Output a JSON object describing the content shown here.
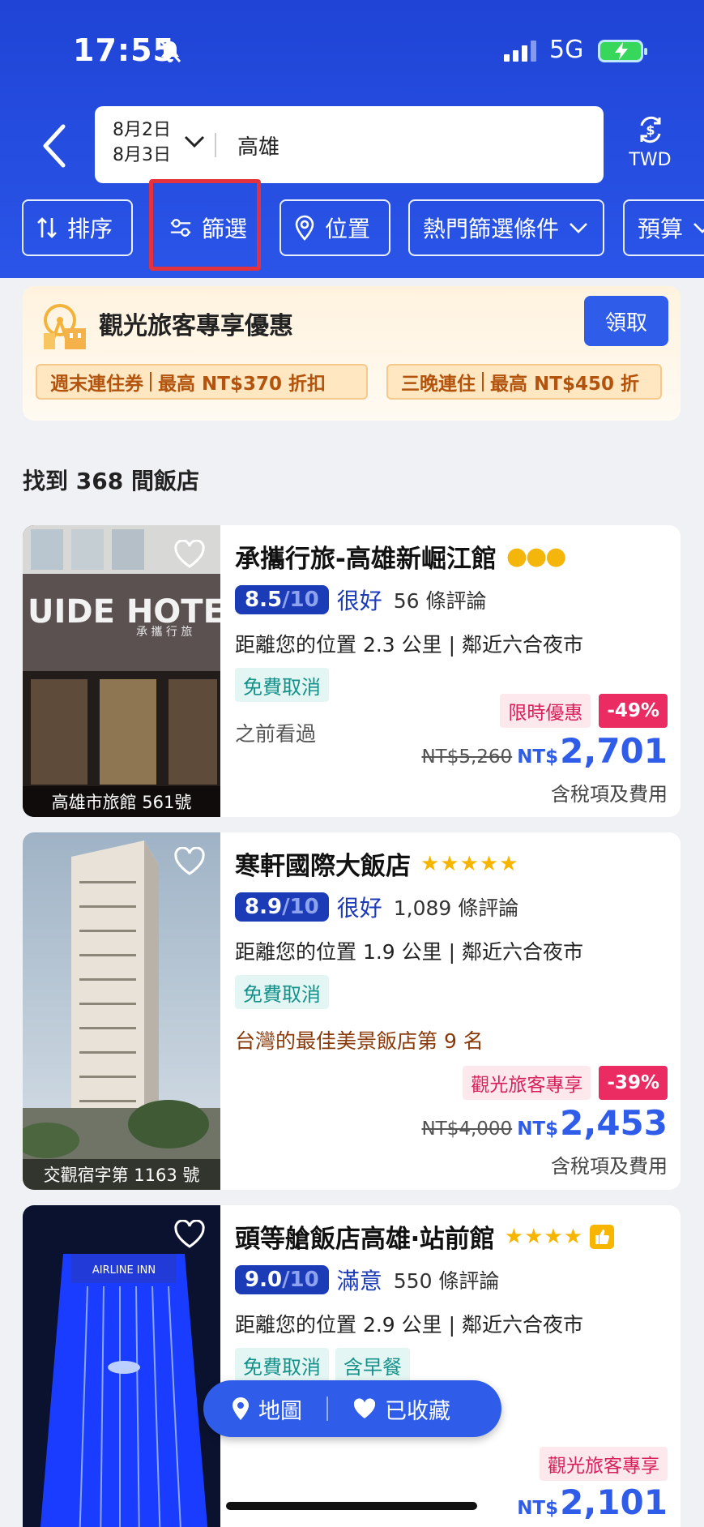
{
  "status": {
    "time": "17:55",
    "network": "5G"
  },
  "search": {
    "date_in": "8月2日",
    "date_out": "8月3日",
    "city": "高雄",
    "currency": "TWD"
  },
  "chips": [
    {
      "label": "排序"
    },
    {
      "label": "篩選"
    },
    {
      "label": "位置"
    },
    {
      "label": "熱門篩選條件"
    },
    {
      "label": "預算"
    }
  ],
  "promo": {
    "title": "觀光旅客專享優惠",
    "claim": "領取",
    "coupons": [
      {
        "name": "週末連住券",
        "desc": "最高 NT$370 折扣"
      },
      {
        "name": "三晚連住",
        "desc": "最高 NT$450 折"
      }
    ]
  },
  "found": "找到 368 間飯店",
  "hotels": [
    {
      "name": "承攜行旅-高雄新崛江館",
      "stars": "●●●",
      "score": "8.5",
      "denom": "/10",
      "word": "很好",
      "reviews": "56 條評論",
      "distance": "距離您的位置 2.3 公里 | 鄰近六合夜市",
      "tags": [
        "免費取消"
      ],
      "note": "之前看過",
      "promo": "限時優惠",
      "discount": "-49%",
      "old": "NT$5,260",
      "currency": "NT$",
      "price": "2,701",
      "tax": "含稅項及費用",
      "license": "高雄市旅館 561號",
      "sign": "UIDE HOTEL",
      "sign2": "承 攜 行 旅"
    },
    {
      "name": "寒軒國際大飯店",
      "stars": "★★★★★",
      "score": "8.9",
      "denom": "/10",
      "word": "很好",
      "reviews": "1,089 條評論",
      "distance": "距離您的位置 1.9 公里 | 鄰近六合夜市",
      "tags": [
        "免費取消"
      ],
      "note": "台灣的最佳美景飯店第 9 名",
      "promo": "觀光旅客專享",
      "discount": "-39%",
      "old": "NT$4,000",
      "currency": "NT$",
      "price": "2,453",
      "tax": "含稅項及費用",
      "license": "交觀宿字第 1163 號"
    },
    {
      "name": "頭等艙飯店高雄‧站前館",
      "stars": "★★★★",
      "score": "9.0",
      "denom": "/10",
      "word": "滿意",
      "reviews": "550 條評論",
      "distance": "距離您的位置 2.9 公里 | 鄰近六合夜市",
      "tags": [
        "免費取消",
        "含早餐"
      ],
      "promo": "觀光旅客專享",
      "currency": "NT$",
      "price": "2,101",
      "sign": "AIRLINE INN"
    }
  ],
  "fab": {
    "map": "地圖",
    "saved": "已收藏"
  }
}
